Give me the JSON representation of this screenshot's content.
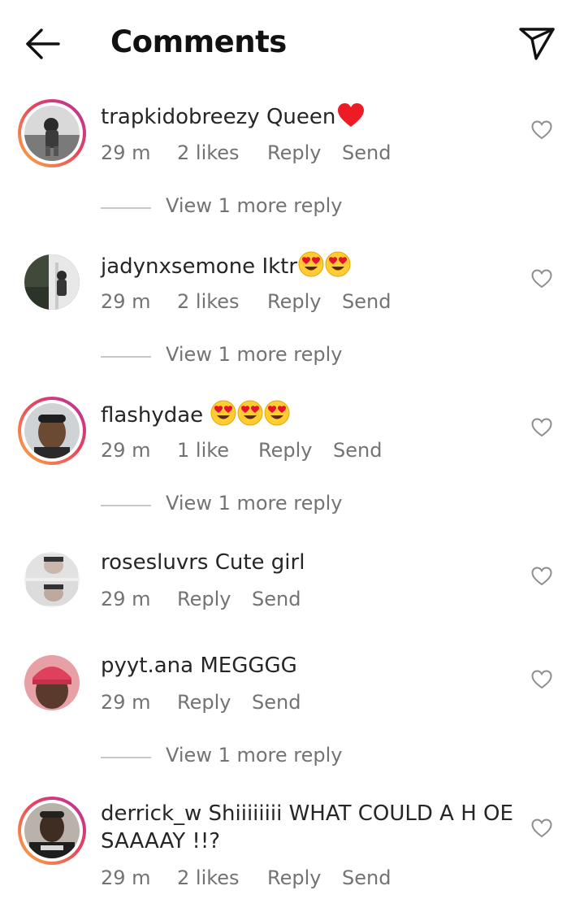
{
  "header": {
    "title": "Comments",
    "back_icon": "arrow-left-icon",
    "share_icon": "paper-plane-icon"
  },
  "colors": {
    "text": "#262626",
    "secondary": "#737373",
    "story_ring_start": "#f9b043",
    "story_ring_end": "#b230a2",
    "heart": "#ed1c24"
  },
  "comments": [
    {
      "username": "trapkidobreezy",
      "text": "Queen",
      "emoji": "red-heart",
      "time": "29 m",
      "likes": "2 likes",
      "reply": "Reply",
      "send": "Send",
      "more_replies": "View 1 more reply",
      "story_ring": true
    },
    {
      "username": "jadynxsemone",
      "text": "Iktr",
      "emoji": "heart-eyes x2",
      "time": "29 m",
      "likes": "2 likes",
      "reply": "Reply",
      "send": "Send",
      "more_replies": "View 1 more reply",
      "story_ring": false
    },
    {
      "username": "flashydae",
      "text": "",
      "emoji": "heart-eyes x3",
      "time": "29 m",
      "likes": "1 like",
      "reply": "Reply",
      "send": "Send",
      "more_replies": "View 1 more reply",
      "story_ring": true
    },
    {
      "username": "rosesluvrs",
      "text": "Cute girl",
      "time": "29 m",
      "reply": "Reply",
      "send": "Send",
      "story_ring": false
    },
    {
      "username": "pyyt.ana",
      "text": "MEGGGG",
      "time": "29 m",
      "reply": "Reply",
      "send": "Send",
      "more_replies": "View 1 more reply",
      "story_ring": false
    },
    {
      "username": "derrick_w",
      "text": "Shiiiiiiii WHAT COULD A H OE SAAAAY !!?",
      "time": "29 m",
      "likes": "2 likes",
      "reply": "Reply",
      "send": "Send",
      "story_ring": true
    }
  ]
}
